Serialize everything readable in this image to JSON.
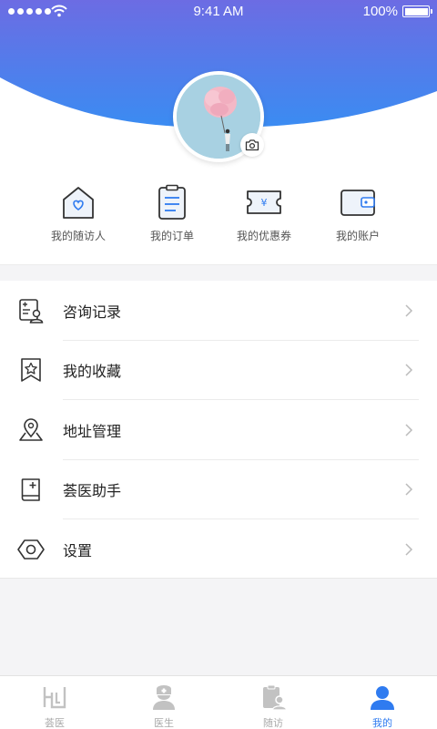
{
  "status_bar": {
    "time": "9:41 AM",
    "battery": "100%"
  },
  "colors": {
    "header_gradient_start": "#6a6fe2",
    "header_gradient_end": "#3c8af1",
    "accent": "#2f7bf0",
    "tab_inactive": "#bbbbbb"
  },
  "profile": {
    "avatar_icon": "avatar-photo",
    "camera_icon": "camera-icon"
  },
  "quick_actions": [
    {
      "label": "我的随访人",
      "icon": "house-heart-icon"
    },
    {
      "label": "我的订单",
      "icon": "clipboard-icon"
    },
    {
      "label": "我的优惠券",
      "icon": "coupon-yen-icon"
    },
    {
      "label": "我的账户",
      "icon": "wallet-icon"
    }
  ],
  "menu": [
    {
      "label": "咨询记录",
      "icon": "record-icon"
    },
    {
      "label": "我的收藏",
      "icon": "bookmark-star-icon"
    },
    {
      "label": "地址管理",
      "icon": "location-pin-icon"
    },
    {
      "label": "荟医助手",
      "icon": "assistant-book-icon"
    },
    {
      "label": "设置",
      "icon": "settings-hexagon-icon"
    }
  ],
  "tabs": [
    {
      "label": "荟医",
      "icon": "home-logo-icon",
      "active": false
    },
    {
      "label": "医生",
      "icon": "doctor-icon",
      "active": false
    },
    {
      "label": "随访",
      "icon": "followup-icon",
      "active": false
    },
    {
      "label": "我的",
      "icon": "user-icon",
      "active": true
    }
  ]
}
